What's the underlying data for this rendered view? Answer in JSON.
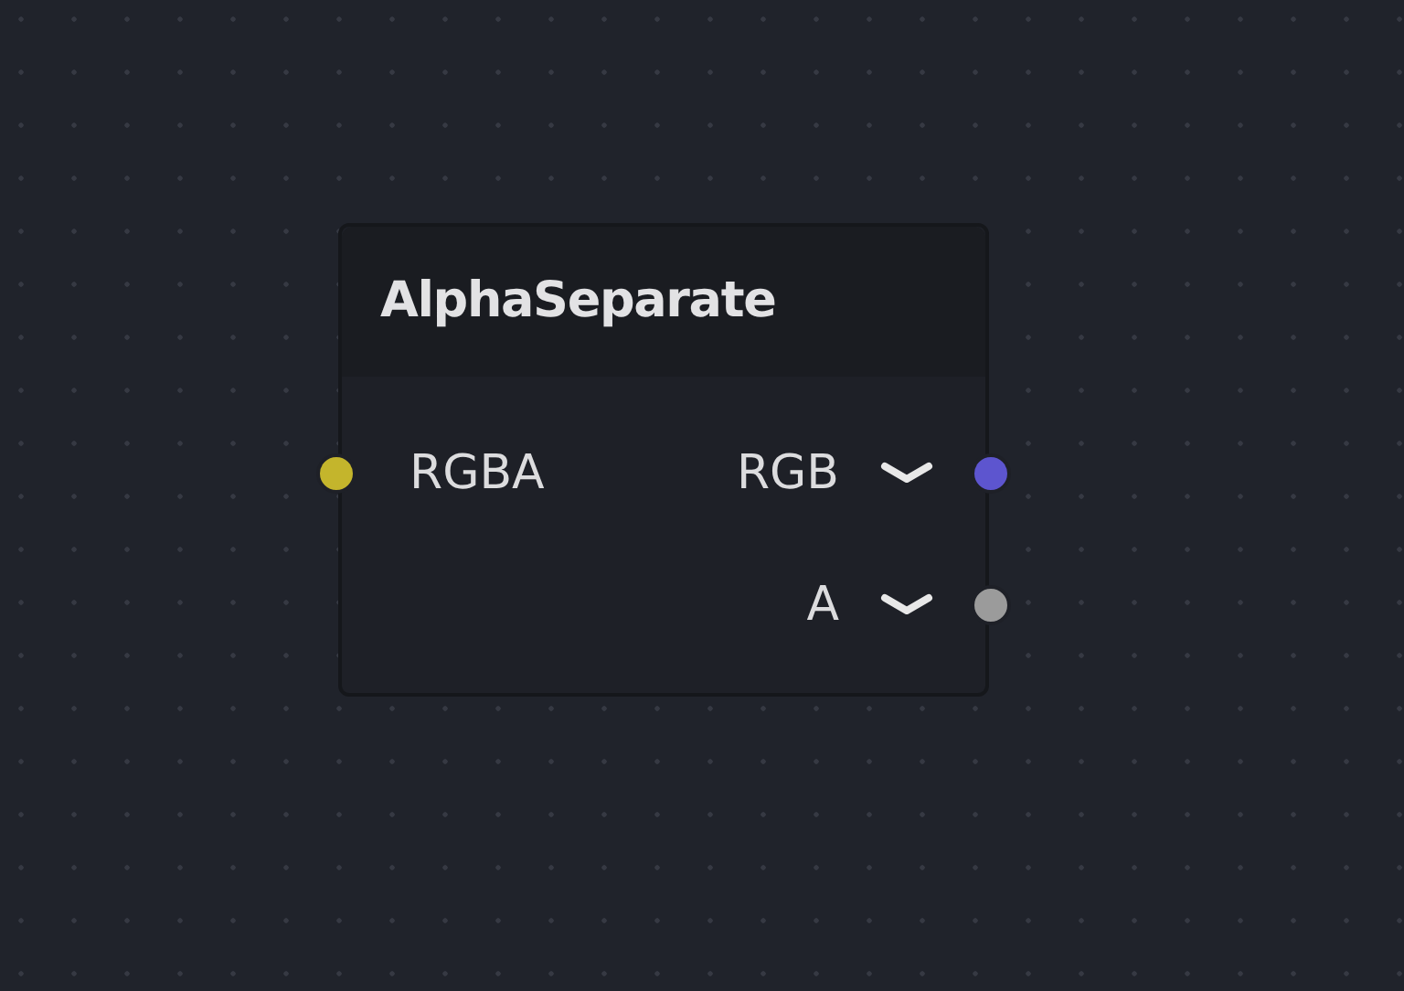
{
  "node": {
    "title": "AlphaSeparate",
    "inputs": [
      {
        "label": "RGBA",
        "color": "#c4b52c"
      }
    ],
    "outputs": [
      {
        "label": "RGB",
        "color": "#5d55cf"
      },
      {
        "label": "A",
        "color": "#9b9b9b"
      }
    ]
  }
}
